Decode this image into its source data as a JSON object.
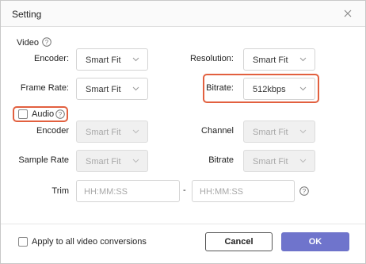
{
  "dialog": {
    "title": "Setting"
  },
  "video": {
    "section_label": "Video",
    "encoder_label": "Encoder:",
    "encoder_value": "Smart Fit",
    "resolution_label": "Resolution:",
    "resolution_value": "Smart Fit",
    "frame_rate_label": "Frame Rate:",
    "frame_rate_value": "Smart Fit",
    "bitrate_label": "Bitrate:",
    "bitrate_value": "512kbps"
  },
  "audio": {
    "section_label": "Audio",
    "checked": false,
    "encoder_label": "Encoder",
    "encoder_value": "Smart Fit",
    "channel_label": "Channel",
    "channel_value": "Smart Fit",
    "sample_rate_label": "Sample Rate",
    "sample_rate_value": "Smart Fit",
    "bitrate_label": "Bitrate",
    "bitrate_value": "Smart Fit"
  },
  "trim": {
    "label": "Trim",
    "start_placeholder": "HH:MM:SS",
    "separator": "-",
    "end_placeholder": "HH:MM:SS"
  },
  "footer": {
    "apply_all_label": "Apply to all video conversions",
    "apply_all_checked": false,
    "cancel_label": "Cancel",
    "ok_label": "OK"
  },
  "colors": {
    "highlight": "#e2603f",
    "ok_button": "#6f74cc"
  },
  "icons": {
    "close": "close-icon",
    "help": "question-circle-icon",
    "dropdown": "chevron-down-icon"
  }
}
